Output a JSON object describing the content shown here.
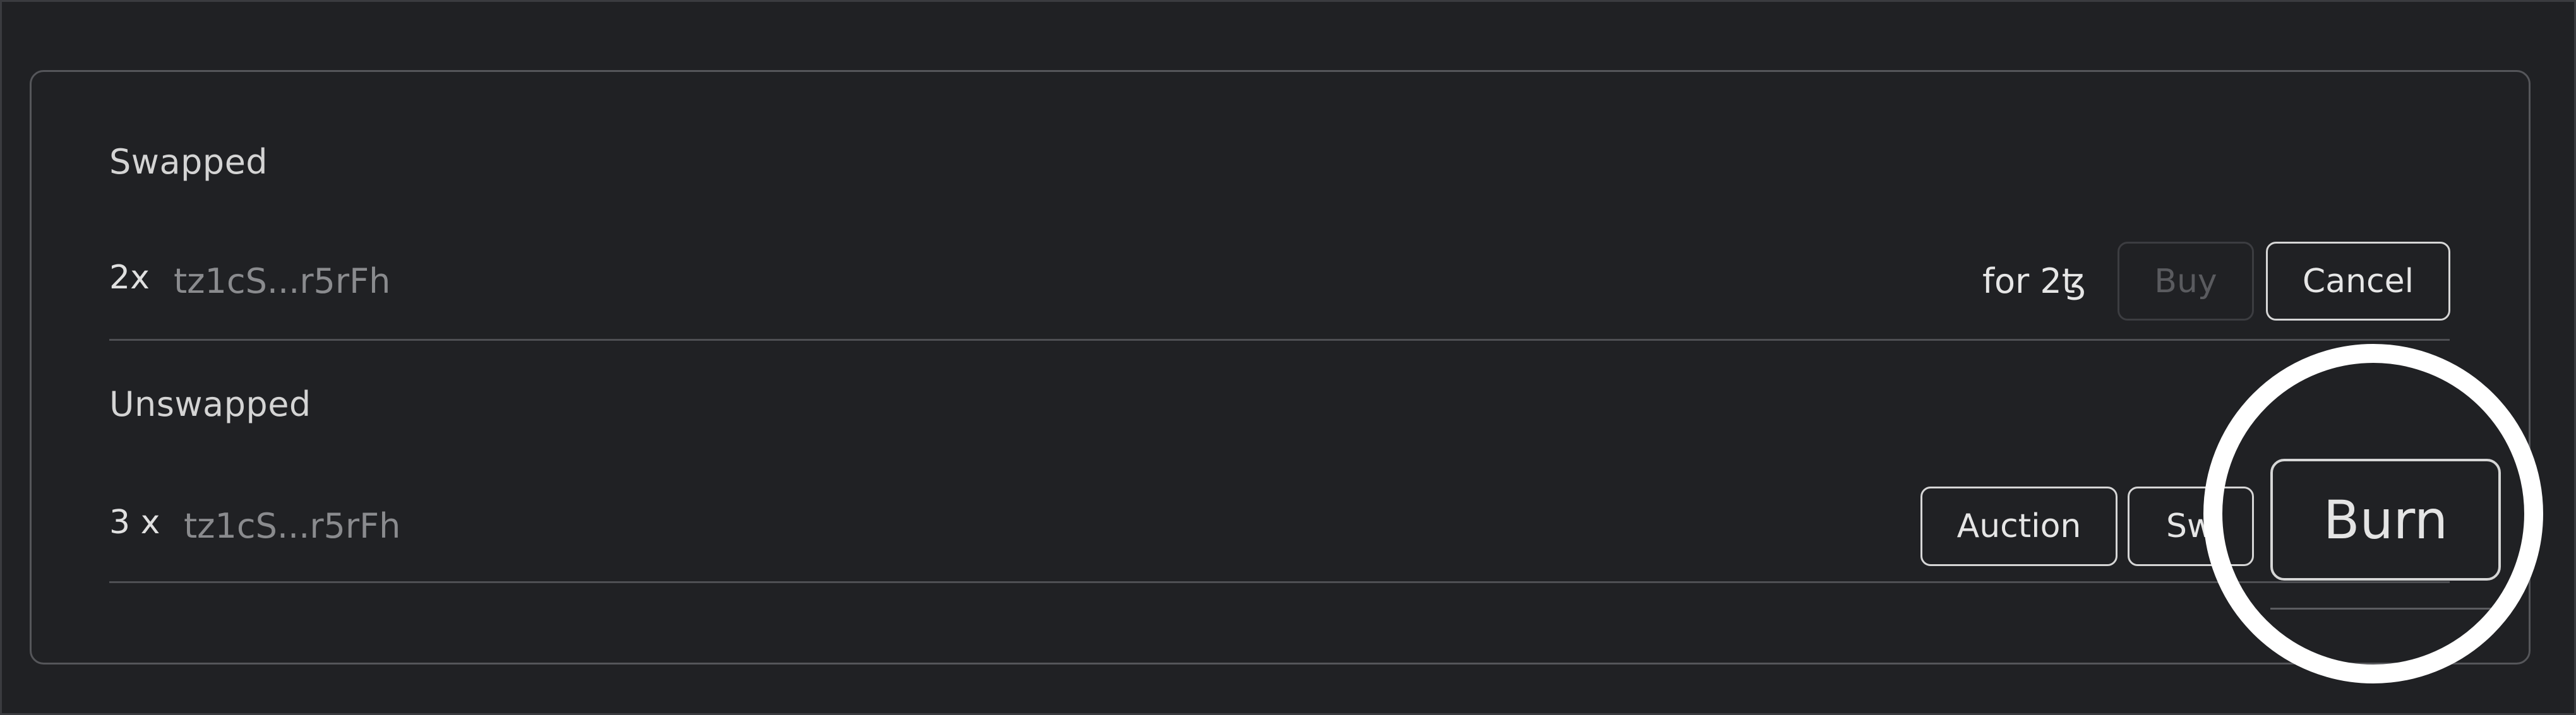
{
  "swapped": {
    "heading": "Swapped",
    "row": {
      "quantity": "2x",
      "address": "tz1cS...r5rFh",
      "price_text": "for 2ꜩ",
      "buy_label": "Buy",
      "cancel_label": "Cancel"
    }
  },
  "unswapped": {
    "heading": "Unswapped",
    "row": {
      "quantity": "3 x",
      "address": "tz1cS...r5rFh",
      "auction_label": "Auction",
      "swap_label": "Sw",
      "burn_label": "Burn"
    }
  },
  "colors": {
    "background": "#202124",
    "highlight": "#ffffff",
    "muted_text": "#8a8b8e"
  }
}
